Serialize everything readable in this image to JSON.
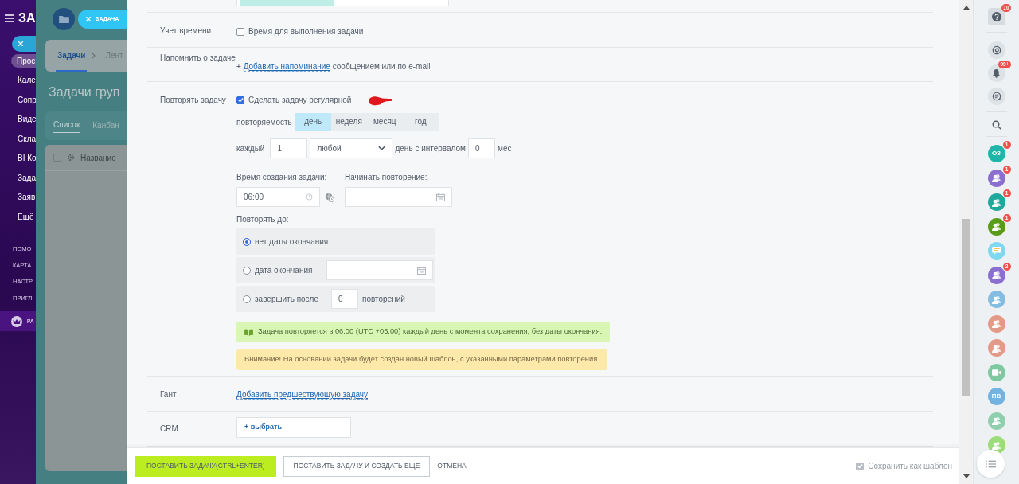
{
  "background_page": {
    "sidebar_title": "ЗА",
    "sidebar_items": [
      {
        "label": "Прос",
        "selected": true
      },
      {
        "label": "Кале",
        "selected": false
      },
      {
        "label": "Сопр",
        "selected": false
      },
      {
        "label": "Виде",
        "selected": false
      },
      {
        "label": "Скла",
        "selected": false
      },
      {
        "label": "BI Ко",
        "selected": false
      },
      {
        "label": "Зада",
        "selected": false
      },
      {
        "label": "Заяв",
        "selected": false
      },
      {
        "label": "Ещё",
        "selected": false
      }
    ],
    "sidebar_links": [
      "ПОМО",
      "КАРТА",
      "НАСТР",
      "ПРИГЛ"
    ],
    "sidebar_footer": "РА",
    "task_chip": "ЗАДАЧА",
    "tabs": [
      {
        "label": "Задачи",
        "selected": true
      },
      {
        "label": "Лент",
        "selected": false
      }
    ],
    "heading": "Задачи груп",
    "view_tabs": [
      {
        "label": "Список",
        "selected": true
      },
      {
        "label": "Канбан",
        "selected": false
      }
    ],
    "grid_select_all": false,
    "grid_column": "Название"
  },
  "form": {
    "time_tracking": {
      "label": "Учет времени",
      "checkbox_label": "Время для выполнения задачи",
      "checked": false
    },
    "reminder": {
      "label": "Напомнить о задаче",
      "plus": "+",
      "link": "Добавить напоминание",
      "suffix": "сообщением или по e-mail"
    },
    "repeat": {
      "label": "Повторять задачу",
      "checkbox_label": "Сделать задачу регулярной",
      "checked": true,
      "period_label": "повторяемость",
      "periods": [
        {
          "label": "день",
          "selected": true
        },
        {
          "label": "неделя",
          "selected": false
        },
        {
          "label": "месяц",
          "selected": false
        },
        {
          "label": "год",
          "selected": false
        }
      ],
      "every_label": "каждый",
      "every_value": "1",
      "day_select": "любой",
      "interval_label": "день с интервалом",
      "interval_value": "0",
      "interval_unit": "мес",
      "time_label": "Время создания задачи:",
      "time_value": "06:00",
      "start_label": "Начинать повторение:",
      "until_label": "Повторять до:",
      "until_options": [
        {
          "kind": "none",
          "label": "нет даты окончания",
          "selected": true
        },
        {
          "kind": "date",
          "label": "дата окончания",
          "selected": false
        },
        {
          "kind": "count",
          "label": "завершить после",
          "value": "0",
          "suffix": "повторений",
          "selected": false
        }
      ],
      "summary": "Задача повторяется в 06:00 (UTC +05:00) каждый день с момента сохранения, без даты окончания.",
      "warning": "Внимание! На основании задачи будет создан новый шаблон, с указанными параметрами повторения."
    },
    "gantt": {
      "label": "Гант",
      "link": "Добавить предшествующую задачу"
    },
    "crm": {
      "label": "CRM",
      "button": "+ выбрать"
    }
  },
  "footer": {
    "submit": "ПОСТАВИТЬ ЗАДАЧУ(CTRL+ENTER)",
    "submit_more": "ПОСТАВИТЬ ЗАДАЧУ И СОЗДАТЬ ЕЩЕ",
    "cancel": "ОТМЕНА",
    "save_template": {
      "label": "Сохранить как шаблон",
      "checked": true
    }
  },
  "right_bar": {
    "help_badge": "10",
    "notifications_badge": "99+",
    "contacts": [
      {
        "kind": "initials",
        "text": "ОЗ",
        "color": "#1fb5a9",
        "badge": "1"
      },
      {
        "kind": "group",
        "color": "#8a6fd1",
        "badge": "1"
      },
      {
        "kind": "group",
        "color": "#1fa89c",
        "badge": "1"
      },
      {
        "kind": "group",
        "color": "#5a9c1a",
        "badge": "1"
      },
      {
        "kind": "chat",
        "color": "#7fd8f2"
      },
      {
        "kind": "group",
        "color": "#8a6fd1",
        "badge": "2"
      },
      {
        "kind": "group",
        "color": "#85bde2"
      },
      {
        "kind": "group",
        "color": "#e39a86"
      },
      {
        "kind": "group",
        "color": "#e39a86"
      },
      {
        "kind": "video",
        "color": "#7fc9a0"
      },
      {
        "kind": "initials",
        "text": "ПВ",
        "color": "#72b3e2"
      },
      {
        "kind": "group",
        "color": "#8fcfae"
      },
      {
        "kind": "group",
        "color": "#9cdc7a"
      }
    ]
  }
}
